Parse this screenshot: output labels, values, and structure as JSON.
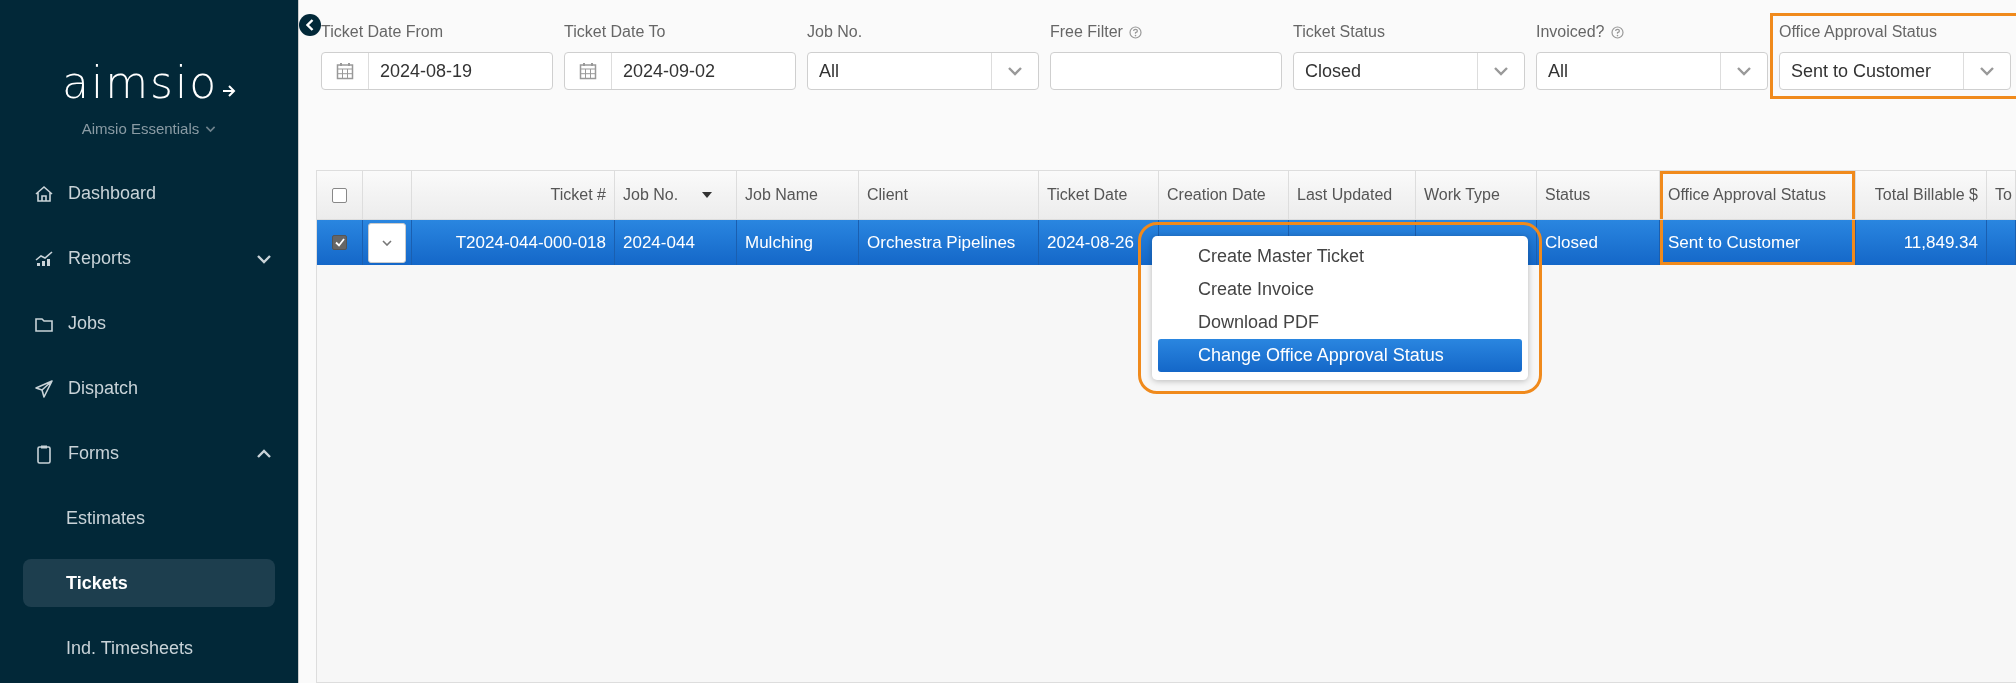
{
  "sidebar": {
    "logo": "aimsio",
    "workspace": "Aimsio Essentials",
    "items": [
      {
        "kind": "link",
        "label": "Dashboard",
        "selected": false
      },
      {
        "kind": "group",
        "label": "Reports",
        "expanded": false
      },
      {
        "kind": "link",
        "label": "Jobs",
        "selected": false
      },
      {
        "kind": "link",
        "label": "Dispatch",
        "selected": false
      },
      {
        "kind": "group",
        "label": "Forms",
        "expanded": true,
        "children": [
          {
            "label": "Estimates",
            "selected": false
          },
          {
            "label": "Tickets",
            "selected": true
          },
          {
            "label": "Ind. Timesheets",
            "selected": false
          }
        ]
      }
    ]
  },
  "filters": [
    {
      "kind": "date",
      "label": "Ticket Date From",
      "value": "2024-08-19",
      "help": false,
      "highlighted": false
    },
    {
      "kind": "date",
      "label": "Ticket Date To",
      "value": "2024-09-02",
      "help": false,
      "highlighted": false
    },
    {
      "kind": "select",
      "label": "Job No.",
      "value": "All",
      "help": false,
      "highlighted": false
    },
    {
      "kind": "text",
      "label": "Free Filter",
      "help": true,
      "highlighted": false
    },
    {
      "kind": "select",
      "label": "Ticket Status",
      "value": "Closed",
      "help": false,
      "highlighted": false
    },
    {
      "kind": "select",
      "label": "Invoiced?",
      "value": "All",
      "help": true,
      "highlighted": false
    },
    {
      "kind": "select",
      "label": "Office Approval Status",
      "value": "Sent to Customer",
      "help": false,
      "highlighted": true
    }
  ],
  "table": {
    "header_checked": false,
    "columns": [
      {
        "label": "Ticket #",
        "kind": "numeric",
        "sorted": false,
        "highlighted": false
      },
      {
        "label": "Job No.",
        "kind": "text",
        "sorted": true,
        "highlighted": false
      },
      {
        "label": "Job Name",
        "kind": "text",
        "sorted": false,
        "highlighted": false
      },
      {
        "label": "Client",
        "kind": "text",
        "sorted": false,
        "highlighted": false
      },
      {
        "label": "Ticket Date",
        "kind": "text",
        "sorted": false,
        "highlighted": false
      },
      {
        "label": "Creation Date",
        "kind": "text",
        "sorted": false,
        "highlighted": false
      },
      {
        "label": "Last Updated",
        "kind": "text",
        "sorted": false,
        "highlighted": false
      },
      {
        "label": "Work Type",
        "kind": "text",
        "sorted": false,
        "highlighted": false
      },
      {
        "label": "Status",
        "kind": "text",
        "sorted": false,
        "highlighted": false
      },
      {
        "label": "Office Approval Status",
        "kind": "text",
        "sorted": false,
        "highlighted": true
      },
      {
        "label": "Total Billable $",
        "kind": "numeric",
        "sorted": false,
        "highlighted": false
      },
      {
        "label": "To",
        "kind": "text",
        "sorted": false,
        "highlighted": false
      }
    ],
    "rows": [
      {
        "selected": true,
        "checked": true,
        "cells": [
          "T2024-044-000-018",
          "2024-044",
          "Mulching",
          "Orchestra Pipelines",
          "2024-08-26",
          null,
          null,
          null,
          "Closed",
          "Sent to Customer",
          "11,849.34",
          null
        ]
      }
    ]
  },
  "context_menu": {
    "highlighted": true,
    "items": [
      {
        "label": "Create Master Ticket",
        "selected": false
      },
      {
        "label": "Create Invoice",
        "selected": false
      },
      {
        "label": "Download PDF",
        "selected": false
      },
      {
        "label": "Change Office Approval Status",
        "selected": true
      }
    ]
  }
}
